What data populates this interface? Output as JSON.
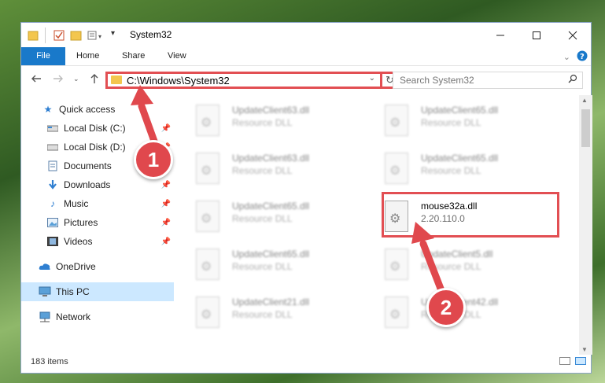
{
  "window": {
    "title": "System32",
    "controls": [
      "minimize",
      "maximize",
      "close"
    ]
  },
  "ribbon": {
    "tabs": [
      "File",
      "Home",
      "Share",
      "View"
    ]
  },
  "address": {
    "path": "C:\\Windows\\System32"
  },
  "search": {
    "placeholder": "Search System32"
  },
  "sidebar": {
    "items": [
      {
        "label": "Quick access",
        "icon": "star-icon"
      },
      {
        "label": "Local Disk (C:)",
        "icon": "drive-icon",
        "pinned": true
      },
      {
        "label": "Local Disk (D:)",
        "icon": "drive-icon",
        "pinned": true
      },
      {
        "label": "Documents",
        "icon": "documents-icon",
        "pinned": true
      },
      {
        "label": "Downloads",
        "icon": "download-icon",
        "pinned": true
      },
      {
        "label": "Music",
        "icon": "music-icon",
        "pinned": true
      },
      {
        "label": "Pictures",
        "icon": "pictures-icon",
        "pinned": true
      },
      {
        "label": "Videos",
        "icon": "videos-icon",
        "pinned": true
      },
      {
        "label": "OneDrive",
        "icon": "cloud-icon"
      },
      {
        "label": "This PC",
        "icon": "computer-icon",
        "selected": true
      },
      {
        "label": "Network",
        "icon": "network-icon"
      }
    ]
  },
  "files": [
    {
      "name": "UpdateClient63.dll",
      "desc": "Resource DLL"
    },
    {
      "name": "UpdateClient65.dll",
      "desc": "Resource DLL"
    },
    {
      "name": "UpdateClient63.dll",
      "desc": "Resource DLL"
    },
    {
      "name": "UpdateClient65.dll",
      "desc": "Resource DLL"
    },
    {
      "name": "UpdateClient65.dll",
      "desc": "Resource DLL"
    },
    {
      "name": "mouse32a.dll",
      "desc": "2.20.110.0"
    },
    {
      "name": "UpdateClient65.dll",
      "desc": "Resource DLL"
    },
    {
      "name": "UpdateClient5.dll",
      "desc": "Resource DLL"
    },
    {
      "name": "UpdateClient21.dll",
      "desc": "Resource DLL"
    },
    {
      "name": "UpdateClient42.dll",
      "desc": "Resource DLL"
    }
  ],
  "status": {
    "count": "183 items"
  },
  "callouts": [
    "1",
    "2"
  ],
  "colors": {
    "accent": "#1979ca",
    "highlight": "#e24f53",
    "selected": "#cce8ff"
  }
}
